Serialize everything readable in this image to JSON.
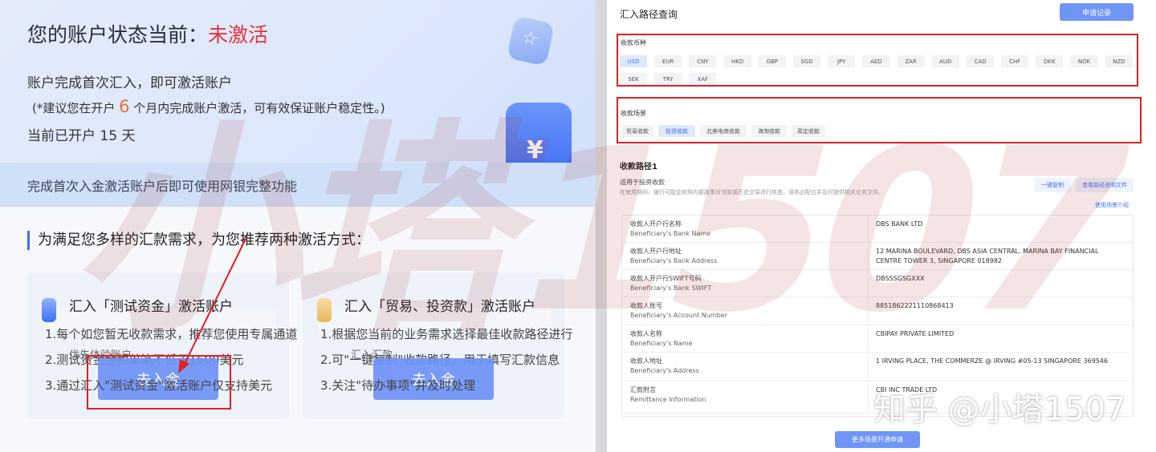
{
  "left": {
    "status_prefix": "您的账户状态当前：",
    "status_value": "未激活",
    "desc_line1": "账户完成首次汇入，即可激活账户",
    "desc_line2_a": "(*建议您在开户 ",
    "desc_line2_num": "6",
    "desc_line2_b": " 个月内完成账户激活，可有效保证账户稳定性。)",
    "desc_line3": "当前已开户 15 天",
    "notice": "完成首次入金激活账户后即可使用网银完整功能",
    "recommend_title": "为满足您多样的汇款需求，为您推荐两种激活方式：",
    "cards": [
      {
        "title": "汇入「测试资金」激活账户",
        "line1": "1.每个如您暂无收款需求，推荐您使用专属通道",
        "line2": "2.测试资金金额单笔不低于1500美元",
        "line2_overlay": "优先体验账户",
        "line3": "3.通过汇入\"测试资金\"激活账户仅支持美元",
        "button": "去入金"
      },
      {
        "title": "汇入「贸易、投资款」激活账户",
        "line1": "1.根据您当前的业务需求选择最佳收款路径进行",
        "line2": "2.可\"一键复制\"收款路径，用于填写汇款信息",
        "line2_overlay": "汇入汇款",
        "line3": "3.关注\"待办事项\"并及时处理",
        "button": "去入金"
      }
    ]
  },
  "right": {
    "title": "汇入路径查询",
    "apply_button": "申请记录",
    "currency_label": "收款币种",
    "currencies": [
      "USD",
      "EUR",
      "CNY",
      "HKD",
      "GBP",
      "SGD",
      "JPY",
      "AED",
      "ZAR",
      "AUD",
      "CAD",
      "CHF",
      "DKK",
      "NOK",
      "NZD",
      "SEK",
      "TRY",
      "XAF"
    ],
    "active_currency": "USD",
    "scene_label": "收款场景",
    "scenes": [
      "贸易收款",
      "投资收款",
      "北美电商收款",
      "海淘收款",
      "周定收款"
    ],
    "active_scene": "投资收款",
    "path_title": "收款路径1",
    "path_sub": "适用于投资收款",
    "path_note": "在使用期间，银行可能会依照内部政策对当前或历史交易进行核查，请务必配合并及时提供相关业务文件。",
    "copy_button": "一键复制",
    "doc_button": "查看路径说明文件",
    "scene_link": "使用场景介绍",
    "rows": [
      {
        "k_cn": "收款人开户行名称",
        "k_en": "Beneficiary's Bank Name",
        "v": "DBS BANK LTD"
      },
      {
        "k_cn": "收款人开户行地址",
        "k_en": "Beneficiary's Bank Address",
        "v": "12 MARINA BOULEVARD, DBS ASIA CENTRAL, MARINA BAY FINANCIAL CENTRE TOWER 3, SINGAPORE 018982"
      },
      {
        "k_cn": "收款人开户行SWIFT号码",
        "k_en": "Beneficiary's Bank SWIFT",
        "v": "DBSSSGSGXXX"
      },
      {
        "k_cn": "收款人账号",
        "k_en": "Beneficiary's Account Number",
        "v": "8851862221110868413"
      },
      {
        "k_cn": "收款人名称",
        "k_en": "Beneficiary's Name",
        "v": "CBIPAY PRIVATE LIMITED"
      },
      {
        "k_cn": "收款人地址",
        "k_en": "Beneficiary's Address",
        "v": "1 IRVING PLACE, THE COMMERZE @ IRVING #05-13 SINGAPORE 369546"
      },
      {
        "k_cn": "汇款附言",
        "k_en": "Remittance Information",
        "v": "CBI INC TRADE LTD"
      }
    ],
    "more_button": "更多场景开通申请"
  },
  "watermark": "小塔1507",
  "zhihu": "知乎 @小塔1507"
}
